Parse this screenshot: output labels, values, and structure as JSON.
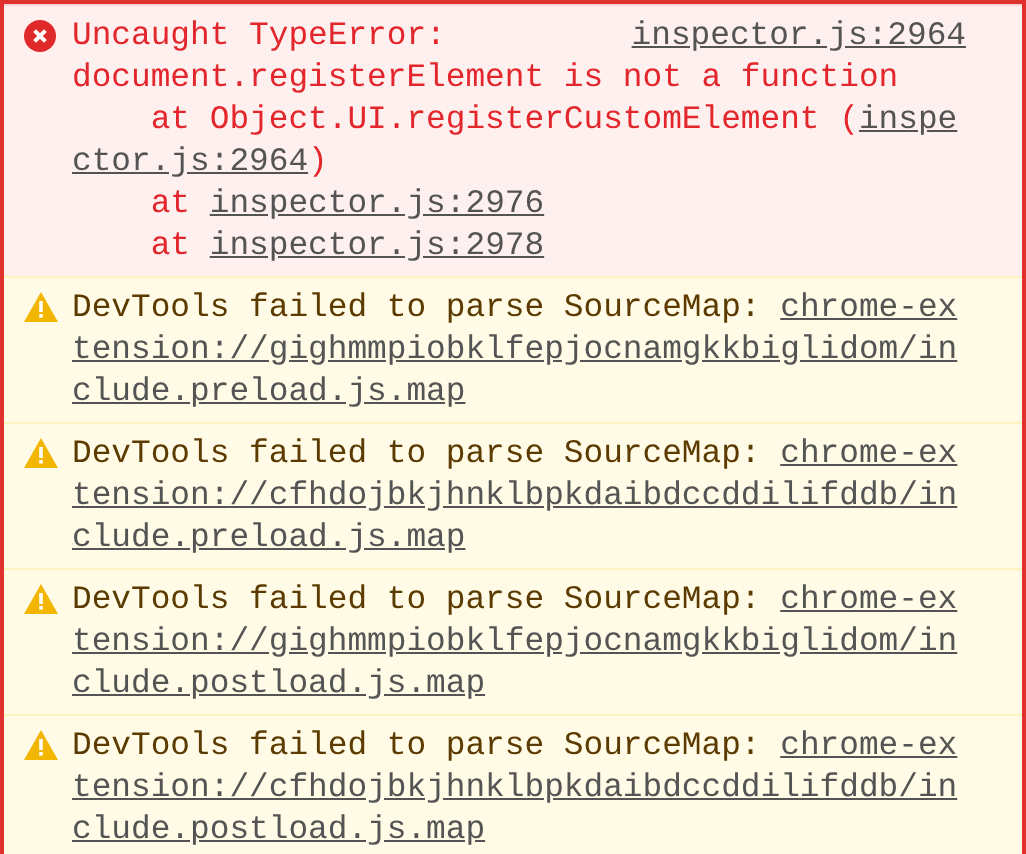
{
  "console_messages": [
    {
      "kind": "error",
      "title": "Uncaught TypeError:",
      "source": "inspector.js:2964",
      "message": "document.registerElement is not a function",
      "stack": [
        {
          "prefix": "at Object.UI.registerCustomElement (",
          "link": "inspector.js:2964",
          "suffix": ")"
        },
        {
          "prefix": "at ",
          "link": "inspector.js:2976"
        },
        {
          "prefix": "at ",
          "link": "inspector.js:2978"
        }
      ]
    },
    {
      "kind": "warning",
      "message": "DevTools failed to parse SourceMap: ",
      "link": "chrome-extension://gighmmpiobklfepjocnamgkkbiglidom/include.preload.js.map"
    },
    {
      "kind": "warning",
      "message": "DevTools failed to parse SourceMap: ",
      "link": "chrome-extension://cfhdojbkjhnklbpkdaibdccddilifddb/include.preload.js.map"
    },
    {
      "kind": "warning",
      "message": "DevTools failed to parse SourceMap: ",
      "link": "chrome-extension://gighmmpiobklfepjocnamgkkbiglidom/include.postload.js.map"
    },
    {
      "kind": "warning",
      "message": "DevTools failed to parse SourceMap: ",
      "link": "chrome-extension://cfhdojbkjhnklbpkdaibdccddilifddb/include.postload.js.map"
    }
  ]
}
